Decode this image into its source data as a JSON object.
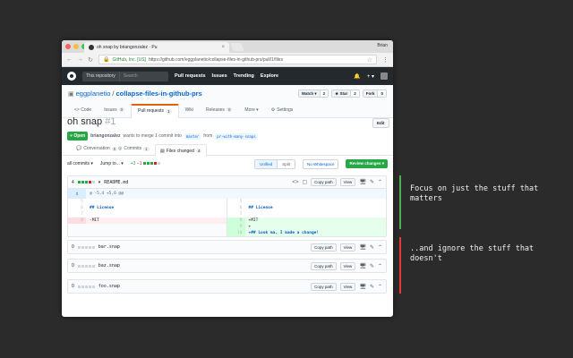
{
  "browser": {
    "tab_title": "oh snap by briangonzalez · Pu",
    "profile": "Brian",
    "secure_label": "GitHub, Inc. [US]",
    "url": "https://github.com/eggplanetio/collapse-files-in-github-prs/pull/1/files"
  },
  "gh_header": {
    "scope": "This repository",
    "search_placeholder": "Search",
    "nav": [
      "Pull requests",
      "Issues",
      "Trending",
      "Explore"
    ]
  },
  "repo": {
    "owner": "eggplanetio",
    "name": "collapse-files-in-github-prs",
    "watch": {
      "label": "Watch ▾",
      "count": "2"
    },
    "star": {
      "label": "★ Star",
      "count": "2"
    },
    "fork": {
      "label": "Fork",
      "count": "0"
    },
    "tabs": [
      {
        "label": "<> Code",
        "count": ""
      },
      {
        "label": "Issues",
        "count": "0"
      },
      {
        "label": "Pull requests",
        "count": "1"
      },
      {
        "label": "Wiki",
        "count": ""
      },
      {
        "label": "Releases",
        "count": "0"
      },
      {
        "label": "More ▾",
        "count": ""
      },
      {
        "label": "Settings",
        "count": ""
      }
    ]
  },
  "pr": {
    "title": "oh snap",
    "number": "#1",
    "edit": "Edit",
    "state": "Open",
    "author": "briangonzalez",
    "meta_mid": "wants to merge 1 commit into",
    "base": "master",
    "meta_from": "from",
    "head": "pr-with-many-snaps",
    "tabs": [
      {
        "label": "Conversation",
        "count": "0"
      },
      {
        "label": "Commits",
        "count": "1"
      },
      {
        "label": "Files changed",
        "count": "4"
      }
    ]
  },
  "file_toolbar": {
    "all_commits": "all commits ▾",
    "jump_to": "Jump to... ▾",
    "additions": "+3",
    "deletions": "−1",
    "unified": "Unified",
    "split": "Split",
    "no_whitespace": "No Whitespace",
    "review": "Review changes ▾"
  },
  "files": [
    {
      "stat": "4",
      "name": "README.md",
      "copy": "Copy path",
      "view": "View",
      "hunk": "@ -5,4 +5,6 @@",
      "left": [
        {
          "no": "5",
          "code": "",
          "type": ""
        },
        {
          "no": "6",
          "code": "## License",
          "type": "kw"
        },
        {
          "no": "7",
          "code": "",
          "type": ""
        },
        {
          "no": "8",
          "code": "-MIT",
          "type": "del"
        }
      ],
      "right": [
        {
          "no": "5",
          "code": "",
          "type": ""
        },
        {
          "no": "6",
          "code": "## License",
          "type": "kw"
        },
        {
          "no": "7",
          "code": "",
          "type": ""
        },
        {
          "no": "8",
          "code": "+MIT",
          "type": "add"
        },
        {
          "no": "9",
          "code": "+",
          "type": "add"
        },
        {
          "no": "10",
          "code": "+## Look ma, I made a change!",
          "type": "addkw"
        }
      ]
    },
    {
      "stat": "0",
      "name": "bar.snap",
      "copy": "Copy path",
      "view": "View"
    },
    {
      "stat": "0",
      "name": "baz.snap",
      "copy": "Copy path",
      "view": "View"
    },
    {
      "stat": "0",
      "name": "foo.snap",
      "copy": "Copy path",
      "view": "View"
    }
  ],
  "annotations": {
    "focus": "Focus on just the stuff that matters",
    "ignore": "..and ignore the stuff that doesn't"
  },
  "colors": {
    "add": "#28a745",
    "del": "#cb2431",
    "accent": "#0366d6"
  }
}
